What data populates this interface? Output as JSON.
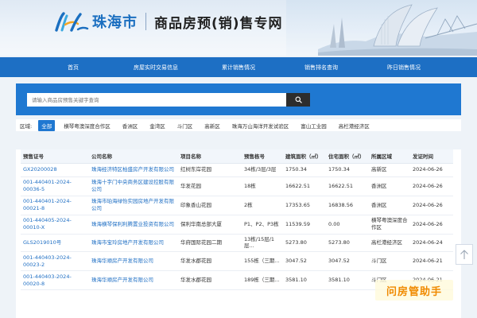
{
  "header": {
    "city_name": "珠海市",
    "site_title": "商品房预(销)售专网"
  },
  "nav": {
    "items": [
      {
        "label": "首页"
      },
      {
        "label": "房屋实时交易信息"
      },
      {
        "label": "累计销售情况"
      },
      {
        "label": "销售排名查询"
      },
      {
        "label": "昨日销售情况"
      }
    ]
  },
  "search": {
    "placeholder": "请输入商品房预售关键字查询"
  },
  "filter": {
    "label": "区域:",
    "active_index": 0,
    "districts": [
      "全部",
      "横琴粤澳深度合作区",
      "香洲区",
      "金湾区",
      "斗门区",
      "高新区",
      "珠海万山海洋开发试验区",
      "富山工业园",
      "高栏港经济区"
    ]
  },
  "table": {
    "columns": [
      "预售证号",
      "公司名称",
      "项目名称",
      "预售栋号",
      "建筑面积（㎡）",
      "住宅面积（㎡）",
      "所属区域",
      "发证时间"
    ],
    "rows": [
      {
        "cert": "GX20200028",
        "company": "珠海经济特区柏盛房产开发有限公司",
        "project": "红树东岸花园",
        "buildings": "34栋/3层/3层",
        "area": "1750.34",
        "res_area": "1750.34",
        "district": "高新区",
        "date": "2024-06-26"
      },
      {
        "cert": "001-440401-2024-00036-5",
        "company": "珠海十字门中央商务区建设控股有限公司",
        "project": "华发花园",
        "buildings": "18栋",
        "area": "16622.51",
        "res_area": "16622.51",
        "district": "香洲区",
        "date": "2024-06-26"
      },
      {
        "cert": "001-440401-2024-00021-8",
        "company": "珠海市珀海绿怡实园房地产开发有限公司",
        "project": "印象香山花园",
        "buildings": "2栋",
        "area": "17353.65",
        "res_area": "16838.56",
        "district": "香洲区",
        "date": "2024-06-26"
      },
      {
        "cert": "001-440405-2024-00010-X",
        "company": "珠海横琴保利利腾置业投资有限公司",
        "project": "保利华南总部大厦",
        "buildings": "P1、P2、P3栋",
        "area": "11539.59",
        "res_area": "0.00",
        "district": "横琴粤澳深度合作区",
        "date": "2024-06-26"
      },
      {
        "cert": "GLS2019010号",
        "company": "珠海市宝玲房地产开发有限公司",
        "project": "华府国际花园二期",
        "buildings": "13栋/15层/1层...",
        "area": "5273.80",
        "res_area": "5273.80",
        "district": "高栏港经济区",
        "date": "2024-06-24"
      },
      {
        "cert": "001-440403-2024-00023-2",
        "company": "珠海华顺房产开发有限公司",
        "project": "华发水郡花园",
        "buildings": "155栋（三期...",
        "area": "3047.52",
        "res_area": "3047.52",
        "district": "斗门区",
        "date": "2024-06-21"
      },
      {
        "cert": "001-440403-2024-00020-8",
        "company": "珠海华顺房产开发有限公司",
        "project": "华发水郡花园",
        "buildings": "189栋（三期...",
        "area": "3581.10",
        "res_area": "3581.10",
        "district": "斗门区",
        "date": "2024-06-21"
      }
    ]
  },
  "watermark": {
    "text": "问房管助手"
  },
  "colors": {
    "primary": "#1d6fc4",
    "search_band": "#1f78d1",
    "link": "#1f6fc4",
    "watermark": "#f08a00"
  },
  "icons": {
    "search": "search-icon",
    "scroll_top": "arrow-up-icon"
  }
}
